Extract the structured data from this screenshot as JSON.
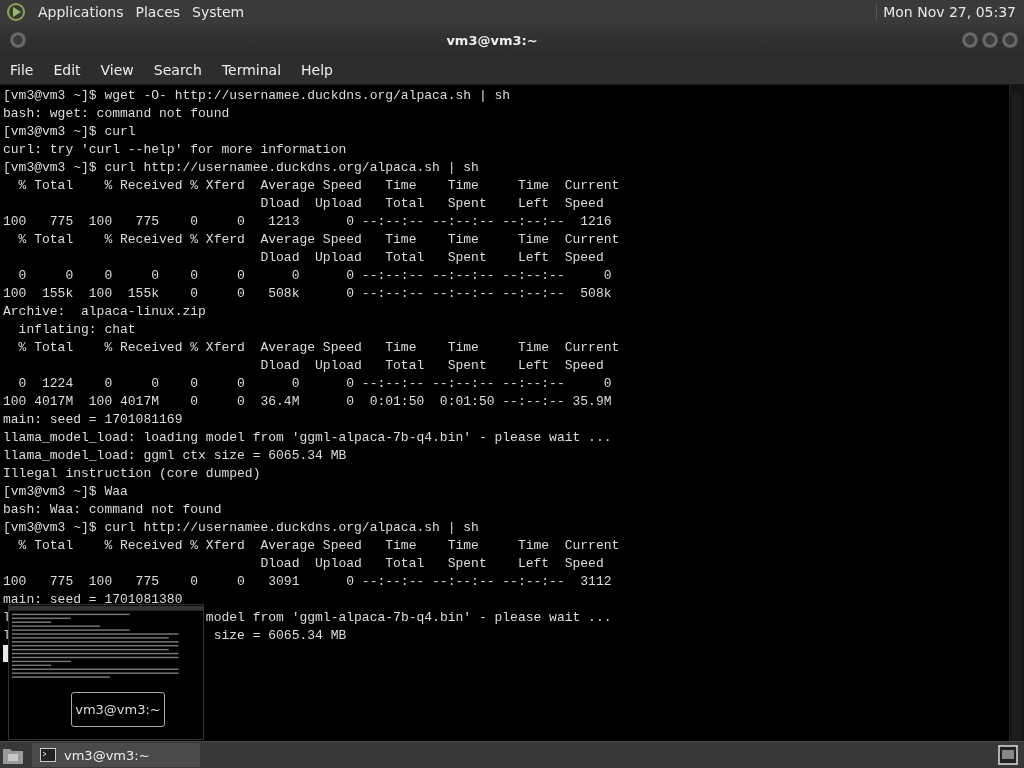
{
  "top_panel": {
    "menus": [
      "Applications",
      "Places",
      "System"
    ],
    "clock": "Mon Nov 27, 05:37"
  },
  "window": {
    "title": "vm3@vm3:~"
  },
  "menu_bar": [
    "File",
    "Edit",
    "View",
    "Search",
    "Terminal",
    "Help"
  ],
  "terminal": {
    "lines": [
      [
        "[vm3@vm3 ~]$ wget -O- http://usernamee.duckdns.org/alpaca.sh | sh"
      ],
      [
        "bash: wget: command not found"
      ],
      [
        "[vm3@vm3 ~]$ curl"
      ],
      [
        "curl: try 'curl --help' for more information"
      ],
      [
        "[vm3@vm3 ~]$ curl http://usernamee.duckdns.org/alpaca.sh | sh"
      ],
      [
        "  % Total    % Received % Xferd  Average Speed   Time    Time     Time  Current"
      ],
      [
        "                                 Dload  Upload   Total   Spent    Left  Speed"
      ],
      [
        "100   775  100   775    0     0   1213      0 --:--:-- --:--:-- --:--:--  1216"
      ],
      [
        "  % Total    % Received % Xferd  Average Speed   Time    Time     Time  Current"
      ],
      [
        "                                 Dload  Upload   Total   Spent    Left  Speed"
      ],
      [
        "  0     0    0     0    0     0      0      0 --:--:-- --:--:-- --:--:--     0"
      ],
      [
        "100  155k  100  155k    0     0   508k      0 --:--:-- --:--:-- --:--:--  508k"
      ],
      [
        "Archive:  alpaca-linux.zip"
      ],
      [
        "  inflating: chat"
      ],
      [
        "  % Total    % Received % Xferd  Average Speed   Time    Time     Time  Current"
      ],
      [
        "                                 Dload  Upload   Total   Spent    Left  Speed"
      ],
      [
        "  0  1224    0     0    0     0      0      0 --:--:-- --:--:-- --:--:--     0"
      ],
      [
        "100 4017M  100 4017M    0     0  36.4M      0  0:01:50  0:01:50 --:--:-- 35.9M"
      ],
      [
        "main: seed = 1701081169"
      ],
      [
        "llama_model_load: loading model from 'ggml-alpaca-7b-q4.bin' - please wait ..."
      ],
      [
        "llama_model_load: ggml ctx size = 6065.34 MB"
      ],
      [
        "Illegal instruction (core dumped)"
      ],
      [
        "[vm3@vm3 ~]$ Waa"
      ],
      [
        "bash: Waa: command not found"
      ],
      [
        "[vm3@vm3 ~]$ curl http://usernamee.duckdns.org/alpaca.sh | sh"
      ],
      [
        "  % Total    % Received % Xferd  Average Speed   Time    Time     Time  Current"
      ],
      [
        "                                 Dload  Upload   Total   Spent    Left  Speed"
      ],
      [
        "100   775  100   775    0     0   3091      0 --:--:-- --:--:-- --:--:--  3112"
      ],
      [
        "main: seed = 1701081380"
      ],
      [
        "l",
        "                         model from 'ggml-alpaca-7b-q4.bin' - please wait ..."
      ],
      [
        "l",
        "                          size = 6065.34 MB"
      ]
    ]
  },
  "window_preview": {
    "label": "vm3@vm3:~"
  },
  "taskbar": {
    "tasks": [
      {
        "label": "vm3@vm3:~",
        "selected": true
      }
    ]
  }
}
